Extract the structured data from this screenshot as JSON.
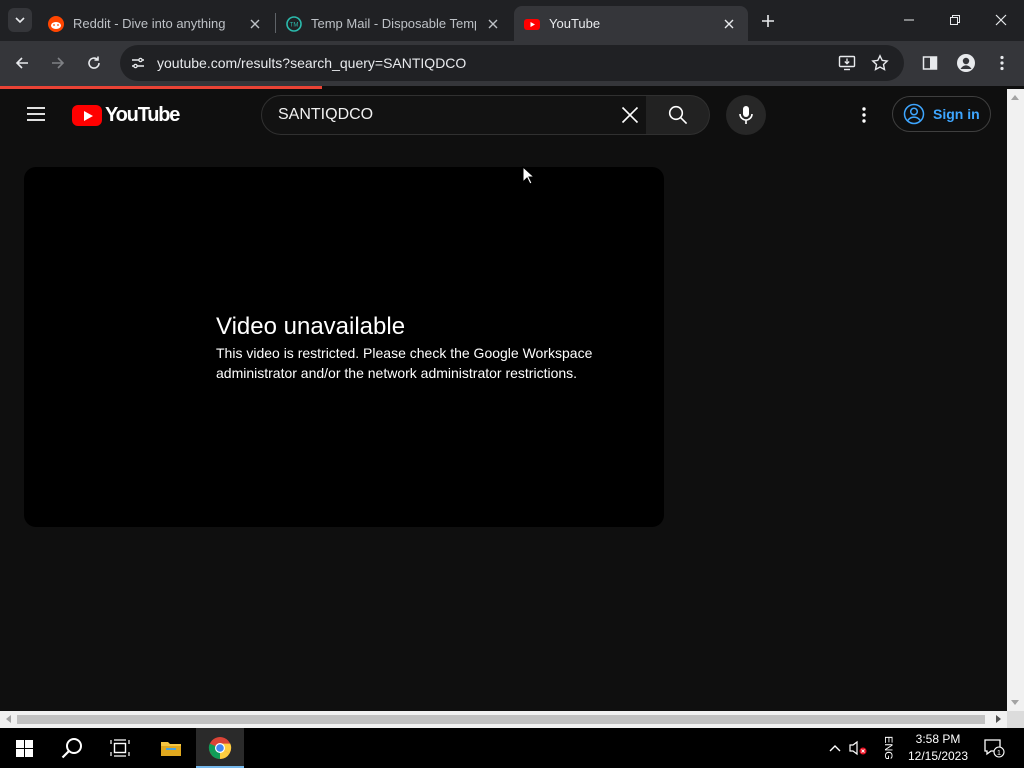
{
  "browser": {
    "tabs": [
      {
        "title": "Reddit - Dive into anything",
        "favicon": "reddit-icon",
        "active": false
      },
      {
        "title": "Temp Mail - Disposable Tempor",
        "favicon": "tempmail-icon",
        "active": false
      },
      {
        "title": "YouTube",
        "favicon": "youtube-icon",
        "active": true
      }
    ],
    "url": "youtube.com/results?search_query=SANTIQDCO",
    "load_progress": 0.31
  },
  "youtube": {
    "search_query": "SANTIQDCO",
    "sign_in_label": "Sign in",
    "logo_text": "YouTube",
    "player": {
      "error_title": "Video unavailable",
      "error_message": "This video is restricted. Please check the Google Workspace administrator and/or the network administrator restrictions."
    }
  },
  "taskbar": {
    "language": "ENG",
    "time": "3:58 PM",
    "date": "12/15/2023",
    "notification_count": "1"
  },
  "colors": {
    "brand_red": "#ff0000",
    "link_blue": "#3ea6ff",
    "page_bg": "#0f0f0f"
  }
}
